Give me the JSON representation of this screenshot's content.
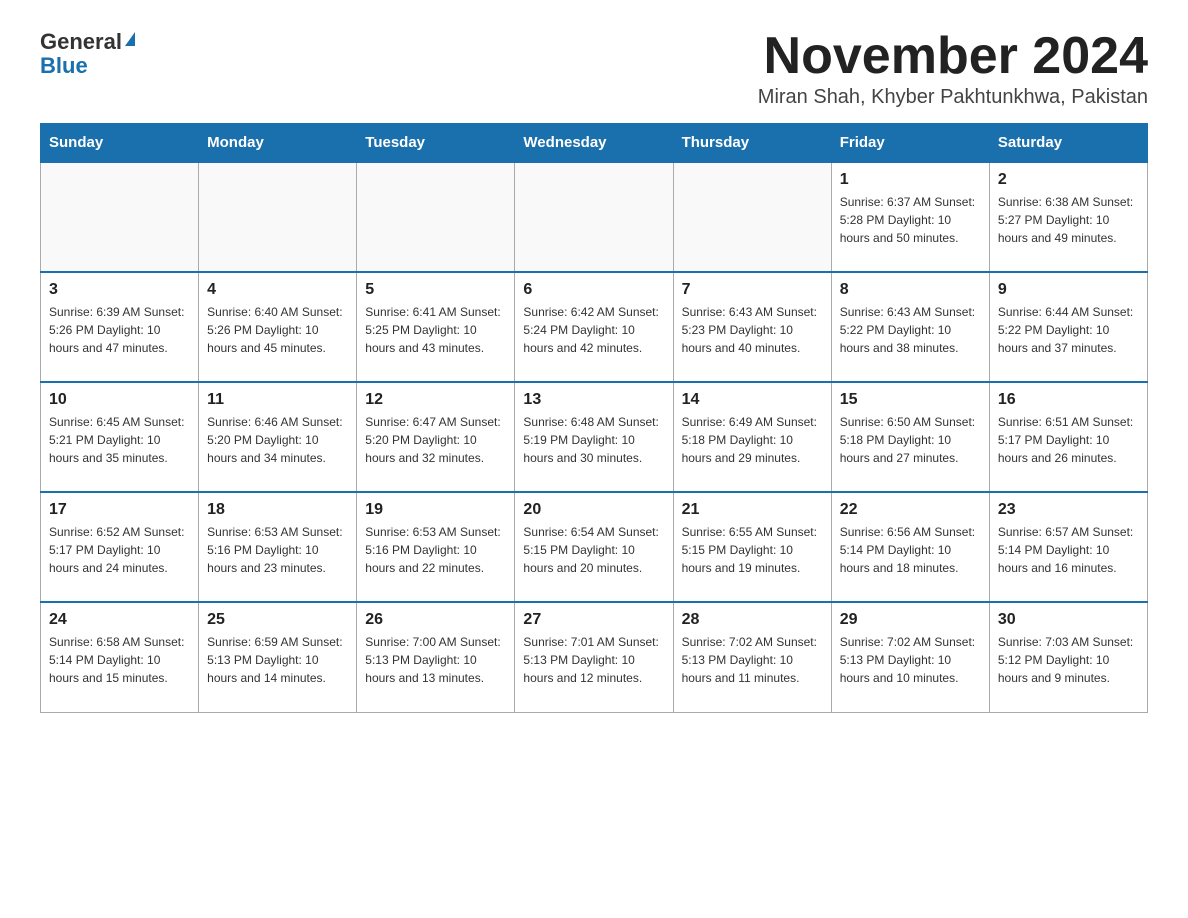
{
  "logo": {
    "general": "General",
    "blue": "Blue"
  },
  "header": {
    "month_year": "November 2024",
    "location": "Miran Shah, Khyber Pakhtunkhwa, Pakistan"
  },
  "days_of_week": [
    "Sunday",
    "Monday",
    "Tuesday",
    "Wednesday",
    "Thursday",
    "Friday",
    "Saturday"
  ],
  "weeks": [
    [
      {
        "day": "",
        "info": ""
      },
      {
        "day": "",
        "info": ""
      },
      {
        "day": "",
        "info": ""
      },
      {
        "day": "",
        "info": ""
      },
      {
        "day": "",
        "info": ""
      },
      {
        "day": "1",
        "info": "Sunrise: 6:37 AM\nSunset: 5:28 PM\nDaylight: 10 hours and 50 minutes."
      },
      {
        "day": "2",
        "info": "Sunrise: 6:38 AM\nSunset: 5:27 PM\nDaylight: 10 hours and 49 minutes."
      }
    ],
    [
      {
        "day": "3",
        "info": "Sunrise: 6:39 AM\nSunset: 5:26 PM\nDaylight: 10 hours and 47 minutes."
      },
      {
        "day": "4",
        "info": "Sunrise: 6:40 AM\nSunset: 5:26 PM\nDaylight: 10 hours and 45 minutes."
      },
      {
        "day": "5",
        "info": "Sunrise: 6:41 AM\nSunset: 5:25 PM\nDaylight: 10 hours and 43 minutes."
      },
      {
        "day": "6",
        "info": "Sunrise: 6:42 AM\nSunset: 5:24 PM\nDaylight: 10 hours and 42 minutes."
      },
      {
        "day": "7",
        "info": "Sunrise: 6:43 AM\nSunset: 5:23 PM\nDaylight: 10 hours and 40 minutes."
      },
      {
        "day": "8",
        "info": "Sunrise: 6:43 AM\nSunset: 5:22 PM\nDaylight: 10 hours and 38 minutes."
      },
      {
        "day": "9",
        "info": "Sunrise: 6:44 AM\nSunset: 5:22 PM\nDaylight: 10 hours and 37 minutes."
      }
    ],
    [
      {
        "day": "10",
        "info": "Sunrise: 6:45 AM\nSunset: 5:21 PM\nDaylight: 10 hours and 35 minutes."
      },
      {
        "day": "11",
        "info": "Sunrise: 6:46 AM\nSunset: 5:20 PM\nDaylight: 10 hours and 34 minutes."
      },
      {
        "day": "12",
        "info": "Sunrise: 6:47 AM\nSunset: 5:20 PM\nDaylight: 10 hours and 32 minutes."
      },
      {
        "day": "13",
        "info": "Sunrise: 6:48 AM\nSunset: 5:19 PM\nDaylight: 10 hours and 30 minutes."
      },
      {
        "day": "14",
        "info": "Sunrise: 6:49 AM\nSunset: 5:18 PM\nDaylight: 10 hours and 29 minutes."
      },
      {
        "day": "15",
        "info": "Sunrise: 6:50 AM\nSunset: 5:18 PM\nDaylight: 10 hours and 27 minutes."
      },
      {
        "day": "16",
        "info": "Sunrise: 6:51 AM\nSunset: 5:17 PM\nDaylight: 10 hours and 26 minutes."
      }
    ],
    [
      {
        "day": "17",
        "info": "Sunrise: 6:52 AM\nSunset: 5:17 PM\nDaylight: 10 hours and 24 minutes."
      },
      {
        "day": "18",
        "info": "Sunrise: 6:53 AM\nSunset: 5:16 PM\nDaylight: 10 hours and 23 minutes."
      },
      {
        "day": "19",
        "info": "Sunrise: 6:53 AM\nSunset: 5:16 PM\nDaylight: 10 hours and 22 minutes."
      },
      {
        "day": "20",
        "info": "Sunrise: 6:54 AM\nSunset: 5:15 PM\nDaylight: 10 hours and 20 minutes."
      },
      {
        "day": "21",
        "info": "Sunrise: 6:55 AM\nSunset: 5:15 PM\nDaylight: 10 hours and 19 minutes."
      },
      {
        "day": "22",
        "info": "Sunrise: 6:56 AM\nSunset: 5:14 PM\nDaylight: 10 hours and 18 minutes."
      },
      {
        "day": "23",
        "info": "Sunrise: 6:57 AM\nSunset: 5:14 PM\nDaylight: 10 hours and 16 minutes."
      }
    ],
    [
      {
        "day": "24",
        "info": "Sunrise: 6:58 AM\nSunset: 5:14 PM\nDaylight: 10 hours and 15 minutes."
      },
      {
        "day": "25",
        "info": "Sunrise: 6:59 AM\nSunset: 5:13 PM\nDaylight: 10 hours and 14 minutes."
      },
      {
        "day": "26",
        "info": "Sunrise: 7:00 AM\nSunset: 5:13 PM\nDaylight: 10 hours and 13 minutes."
      },
      {
        "day": "27",
        "info": "Sunrise: 7:01 AM\nSunset: 5:13 PM\nDaylight: 10 hours and 12 minutes."
      },
      {
        "day": "28",
        "info": "Sunrise: 7:02 AM\nSunset: 5:13 PM\nDaylight: 10 hours and 11 minutes."
      },
      {
        "day": "29",
        "info": "Sunrise: 7:02 AM\nSunset: 5:13 PM\nDaylight: 10 hours and 10 minutes."
      },
      {
        "day": "30",
        "info": "Sunrise: 7:03 AM\nSunset: 5:12 PM\nDaylight: 10 hours and 9 minutes."
      }
    ]
  ]
}
